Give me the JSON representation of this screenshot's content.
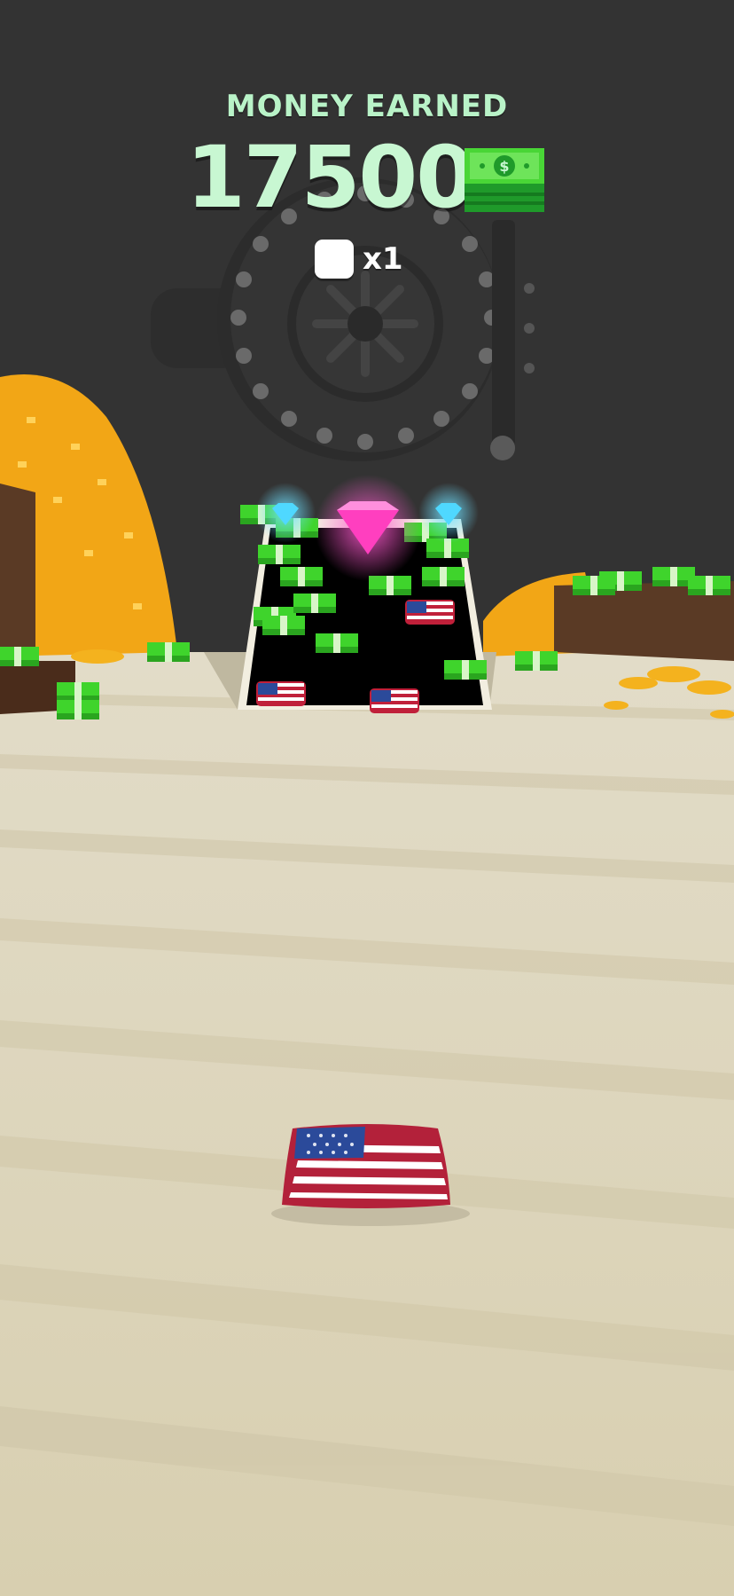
{
  "hud": {
    "title": "MONEY EARNED",
    "score": "17500",
    "currency_icon": "dollar-bill-icon",
    "multiplier_icon": "bean-bag-icon",
    "multiplier": "x1"
  },
  "colors": {
    "background": "#333333",
    "floor": "#d8d0b8",
    "hud_text": "#c8f7d2",
    "cash_green": "#44d62c",
    "gold": "#f4a81e",
    "gem_pink": "#ff3fbf",
    "gem_blue": "#4fd8ff"
  }
}
